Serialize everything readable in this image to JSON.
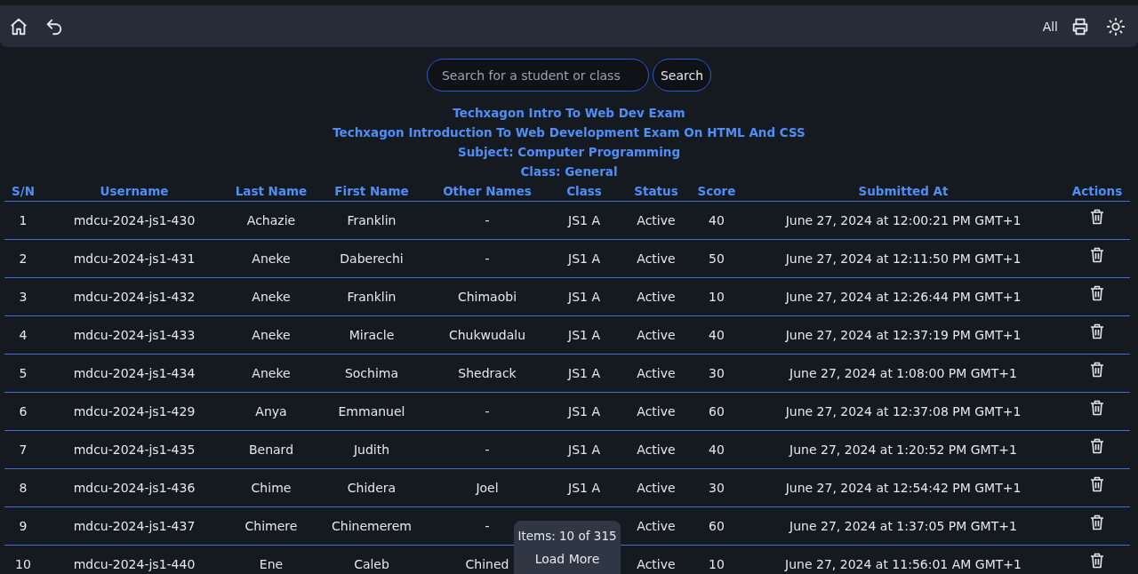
{
  "toolbar": {
    "filter_label": "All"
  },
  "search": {
    "placeholder": "Search for a student or class",
    "button": "Search"
  },
  "headings": [
    "Techxagon Intro To Web Dev Exam",
    "Techxagon Introduction To Web Development Exam On HTML And CSS",
    "Subject: Computer Programming",
    "Class: General"
  ],
  "table": {
    "columns": [
      "S/N",
      "Username",
      "Last Name",
      "First Name",
      "Other Names",
      "Class",
      "Status",
      "Score",
      "Submitted At",
      "Actions"
    ],
    "rows": [
      {
        "sn": "1",
        "username": "mdcu-2024-js1-430",
        "last_name": "Achazie",
        "first_name": "Franklin",
        "other_names": "-",
        "class": "JS1 A",
        "status": "Active",
        "score": "40",
        "submitted_at": "June 27, 2024 at 12:00:21 PM GMT+1"
      },
      {
        "sn": "2",
        "username": "mdcu-2024-js1-431",
        "last_name": "Aneke",
        "first_name": "Daberechi",
        "other_names": "-",
        "class": "JS1 A",
        "status": "Active",
        "score": "50",
        "submitted_at": "June 27, 2024 at 12:11:50 PM GMT+1"
      },
      {
        "sn": "3",
        "username": "mdcu-2024-js1-432",
        "last_name": "Aneke",
        "first_name": "Franklin",
        "other_names": "Chimaobi",
        "class": "JS1 A",
        "status": "Active",
        "score": "10",
        "submitted_at": "June 27, 2024 at 12:26:44 PM GMT+1"
      },
      {
        "sn": "4",
        "username": "mdcu-2024-js1-433",
        "last_name": "Aneke",
        "first_name": "Miracle",
        "other_names": "Chukwudalu",
        "class": "JS1 A",
        "status": "Active",
        "score": "40",
        "submitted_at": "June 27, 2024 at 12:37:19 PM GMT+1"
      },
      {
        "sn": "5",
        "username": "mdcu-2024-js1-434",
        "last_name": "Aneke",
        "first_name": "Sochima",
        "other_names": "Shedrack",
        "class": "JS1 A",
        "status": "Active",
        "score": "30",
        "submitted_at": "June 27, 2024 at 1:08:00 PM GMT+1"
      },
      {
        "sn": "6",
        "username": "mdcu-2024-js1-429",
        "last_name": "Anya",
        "first_name": "Emmanuel",
        "other_names": "-",
        "class": "JS1 A",
        "status": "Active",
        "score": "60",
        "submitted_at": "June 27, 2024 at 12:37:08 PM GMT+1"
      },
      {
        "sn": "7",
        "username": "mdcu-2024-js1-435",
        "last_name": "Benard",
        "first_name": "Judith",
        "other_names": "-",
        "class": "JS1 A",
        "status": "Active",
        "score": "40",
        "submitted_at": "June 27, 2024 at 1:20:52 PM GMT+1"
      },
      {
        "sn": "8",
        "username": "mdcu-2024-js1-436",
        "last_name": "Chime",
        "first_name": "Chidera",
        "other_names": "Joel",
        "class": "JS1 A",
        "status": "Active",
        "score": "30",
        "submitted_at": "June 27, 2024 at 12:54:42 PM GMT+1"
      },
      {
        "sn": "9",
        "username": "mdcu-2024-js1-437",
        "last_name": "Chimere",
        "first_name": "Chinemerem",
        "other_names": "-",
        "status": "Active",
        "score": "60",
        "submitted_at": "June 27, 2024 at 1:37:05 PM GMT+1"
      },
      {
        "sn": "10",
        "username": "mdcu-2024-js1-440",
        "last_name": "Ene",
        "first_name": "Caleb",
        "other_names": "Chined",
        "status": "Active",
        "score": "10",
        "submitted_at": "June 27, 2024 at 11:56:01 AM GMT+1"
      }
    ]
  },
  "pager": {
    "count": "Items: 10 of 315",
    "button": "Load More"
  }
}
